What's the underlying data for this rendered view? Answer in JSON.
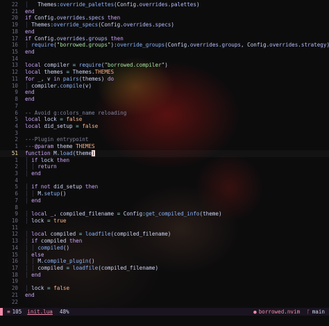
{
  "editor": {
    "lines": [
      {
        "num": "22",
        "sign": "",
        "tokens": [
          [
            "guide",
            "│ "
          ],
          [
            "id",
            "  Themes"
          ],
          [
            "op",
            ":"
          ],
          [
            "fn",
            "override_palettes"
          ],
          [
            "id",
            "(Config"
          ],
          [
            "op",
            "."
          ],
          [
            "field",
            "overrides"
          ],
          [
            "op",
            "."
          ],
          [
            "field",
            "palettes"
          ],
          [
            "id",
            ")"
          ]
        ]
      },
      {
        "num": "21",
        "sign": "",
        "tokens": [
          [
            "kw",
            "end"
          ]
        ]
      },
      {
        "num": "20",
        "sign": "",
        "tokens": [
          [
            "kw",
            "if "
          ],
          [
            "id",
            "Config"
          ],
          [
            "op",
            "."
          ],
          [
            "field",
            "overrides"
          ],
          [
            "op",
            "."
          ],
          [
            "field",
            "specs"
          ],
          [
            "kw",
            " then"
          ]
        ]
      },
      {
        "num": "19",
        "sign": "",
        "tokens": [
          [
            "guide",
            "│ "
          ],
          [
            "id",
            "Themes"
          ],
          [
            "op",
            ":"
          ],
          [
            "fn",
            "override_specs"
          ],
          [
            "id",
            "(Config"
          ],
          [
            "op",
            "."
          ],
          [
            "field",
            "overrides"
          ],
          [
            "op",
            "."
          ],
          [
            "field",
            "specs"
          ],
          [
            "id",
            ")"
          ]
        ]
      },
      {
        "num": "18",
        "sign": "",
        "tokens": [
          [
            "kw",
            "end"
          ]
        ]
      },
      {
        "num": "17",
        "sign": "",
        "tokens": [
          [
            "kw",
            "if "
          ],
          [
            "id",
            "Config"
          ],
          [
            "op",
            "."
          ],
          [
            "field",
            "overrides"
          ],
          [
            "op",
            "."
          ],
          [
            "field",
            "groups"
          ],
          [
            "kw",
            " then"
          ]
        ]
      },
      {
        "num": "16",
        "sign": "",
        "tokens": [
          [
            "guide",
            "│ "
          ],
          [
            "fn",
            "require"
          ],
          [
            "id",
            "("
          ],
          [
            "str",
            "\"borrowed.groups\""
          ],
          [
            "id",
            ")"
          ],
          [
            "op",
            ":"
          ],
          [
            "fn",
            "override_groups"
          ],
          [
            "id",
            "(Config"
          ],
          [
            "op",
            "."
          ],
          [
            "field",
            "overrides"
          ],
          [
            "op",
            "."
          ],
          [
            "field",
            "groups"
          ],
          [
            "id",
            ", Config"
          ],
          [
            "op",
            "."
          ],
          [
            "field",
            "overrides"
          ],
          [
            "op",
            "."
          ],
          [
            "field",
            "strategy"
          ],
          [
            "id",
            ")"
          ]
        ]
      },
      {
        "num": "15",
        "sign": "",
        "tokens": [
          [
            "kw",
            "end"
          ]
        ]
      },
      {
        "num": "14",
        "sign": "",
        "tokens": []
      },
      {
        "num": "13",
        "sign": "",
        "tokens": [
          [
            "kw",
            "local "
          ],
          [
            "id",
            "compiler "
          ],
          [
            "op",
            "= "
          ],
          [
            "fn",
            "require"
          ],
          [
            "id",
            "("
          ],
          [
            "str",
            "\"borrowed.compiler\""
          ],
          [
            "id",
            ")"
          ]
        ]
      },
      {
        "num": "12",
        "sign": "",
        "tokens": [
          [
            "kw",
            "local "
          ],
          [
            "id",
            "themes "
          ],
          [
            "op",
            "= "
          ],
          [
            "id",
            "Themes"
          ],
          [
            "op",
            "."
          ],
          [
            "bool",
            "THEMES"
          ]
        ]
      },
      {
        "num": "11",
        "sign": "",
        "tokens": [
          [
            "kw",
            "for "
          ],
          [
            "id",
            "_, v "
          ],
          [
            "kw",
            "in "
          ],
          [
            "fn",
            "pairs"
          ],
          [
            "id",
            "(themes) "
          ],
          [
            "kw",
            "do"
          ]
        ]
      },
      {
        "num": "10",
        "sign": "",
        "tokens": [
          [
            "guide",
            "│ "
          ],
          [
            "id",
            "compiler"
          ],
          [
            "op",
            "."
          ],
          [
            "fn",
            "compile"
          ],
          [
            "id",
            "(v)"
          ]
        ]
      },
      {
        "num": "9",
        "sign": "",
        "tokens": [
          [
            "kw",
            "end"
          ]
        ]
      },
      {
        "num": "8",
        "sign": "",
        "tokens": [
          [
            "kw",
            "end"
          ]
        ]
      },
      {
        "num": "7",
        "sign": "",
        "tokens": []
      },
      {
        "num": "6",
        "sign": "",
        "tokens": [
          [
            "cm",
            "-- Avoid g:colors_name reloading"
          ]
        ]
      },
      {
        "num": "5",
        "sign": "",
        "tokens": [
          [
            "kw",
            "local "
          ],
          [
            "id",
            "lock "
          ],
          [
            "op",
            "= "
          ],
          [
            "bool",
            "false"
          ]
        ]
      },
      {
        "num": "4",
        "sign": "",
        "tokens": [
          [
            "kw",
            "local "
          ],
          [
            "id",
            "did_setup "
          ],
          [
            "op",
            "= "
          ],
          [
            "bool",
            "false"
          ]
        ]
      },
      {
        "num": "3",
        "sign": "",
        "tokens": []
      },
      {
        "num": "2",
        "sign": "",
        "tokens": [
          [
            "cm",
            "---Plugin entrypoint"
          ]
        ]
      },
      {
        "num": "1",
        "sign": "",
        "tokens": [
          [
            "cm",
            "---"
          ],
          [
            "tag",
            "@param "
          ],
          [
            "id",
            "theme "
          ],
          [
            "bool",
            "THEMES"
          ]
        ]
      },
      {
        "num": "51",
        "sign": "",
        "current": true,
        "tokens": [
          [
            "kw",
            "function "
          ],
          [
            "id",
            "M"
          ],
          [
            "op",
            "."
          ],
          [
            "fn",
            "load"
          ],
          [
            "id",
            "(theme"
          ],
          [
            "cursor",
            ")"
          ]
        ]
      },
      {
        "num": "1",
        "sign": "",
        "tokens": [
          [
            "guide",
            "│ "
          ],
          [
            "kw",
            "if "
          ],
          [
            "id",
            "lock "
          ],
          [
            "kw",
            "then"
          ]
        ]
      },
      {
        "num": "2",
        "sign": "",
        "tokens": [
          [
            "guide",
            "│ "
          ],
          [
            "guide",
            "│ "
          ],
          [
            "kw",
            "return"
          ]
        ]
      },
      {
        "num": "3",
        "sign": "",
        "tokens": [
          [
            "guide",
            "│ "
          ],
          [
            "kw",
            "end"
          ]
        ]
      },
      {
        "num": "4",
        "sign": "",
        "tokens": []
      },
      {
        "num": "5",
        "sign": "",
        "tokens": [
          [
            "guide",
            "│ "
          ],
          [
            "kw",
            "if not "
          ],
          [
            "id",
            "did_setup "
          ],
          [
            "kw",
            "then"
          ]
        ]
      },
      {
        "num": "6",
        "sign": "",
        "tokens": [
          [
            "guide",
            "│ "
          ],
          [
            "guide",
            "│ "
          ],
          [
            "id",
            "M"
          ],
          [
            "op",
            "."
          ],
          [
            "fn",
            "setup"
          ],
          [
            "id",
            "()"
          ]
        ]
      },
      {
        "num": "7",
        "sign": "",
        "tokens": [
          [
            "guide",
            "│ "
          ],
          [
            "kw",
            "end"
          ]
        ]
      },
      {
        "num": "8",
        "sign": "",
        "tokens": []
      },
      {
        "num": "9",
        "sign": "",
        "tokens": [
          [
            "guide",
            "│ "
          ],
          [
            "kw",
            "local "
          ],
          [
            "id",
            "_, compiled_filename "
          ],
          [
            "op",
            "= "
          ],
          [
            "id",
            "Config"
          ],
          [
            "op",
            ":"
          ],
          [
            "fn",
            "get_compiled_info"
          ],
          [
            "id",
            "(theme)"
          ]
        ]
      },
      {
        "num": "10",
        "sign": "",
        "tokens": [
          [
            "guide",
            "│ "
          ],
          [
            "id",
            "lock "
          ],
          [
            "op",
            "= "
          ],
          [
            "bool",
            "true"
          ]
        ]
      },
      {
        "num": "11",
        "sign": "",
        "tokens": []
      },
      {
        "num": "12",
        "sign": "",
        "tokens": [
          [
            "guide",
            "│ "
          ],
          [
            "kw",
            "local "
          ],
          [
            "id",
            "compiled "
          ],
          [
            "op",
            "= "
          ],
          [
            "fn",
            "loadfile"
          ],
          [
            "id",
            "(compiled_filename)"
          ]
        ]
      },
      {
        "num": "13",
        "sign": "",
        "tokens": [
          [
            "guide",
            "│ "
          ],
          [
            "kw",
            "if "
          ],
          [
            "id",
            "compiled "
          ],
          [
            "kw",
            "then"
          ]
        ]
      },
      {
        "num": "14",
        "sign": "",
        "tokens": [
          [
            "guide",
            "│ "
          ],
          [
            "guide",
            "│ "
          ],
          [
            "fn",
            "compiled"
          ],
          [
            "id",
            "()"
          ]
        ]
      },
      {
        "num": "15",
        "sign": "",
        "tokens": [
          [
            "guide",
            "│ "
          ],
          [
            "kw",
            "else"
          ]
        ]
      },
      {
        "num": "16",
        "sign": "",
        "tokens": [
          [
            "guide",
            "│ "
          ],
          [
            "guide",
            "│ "
          ],
          [
            "id",
            "M"
          ],
          [
            "op",
            "."
          ],
          [
            "fn",
            "compile_plugin"
          ],
          [
            "id",
            "()"
          ]
        ]
      },
      {
        "num": "17",
        "sign": "",
        "tokens": [
          [
            "guide",
            "│ "
          ],
          [
            "guide",
            "│ "
          ],
          [
            "id",
            "compiled "
          ],
          [
            "op",
            "= "
          ],
          [
            "fn",
            "loadfile"
          ],
          [
            "id",
            "(compiled_filename)"
          ]
        ]
      },
      {
        "num": "18",
        "sign": "",
        "tokens": [
          [
            "guide",
            "│ "
          ],
          [
            "kw",
            "end"
          ]
        ]
      },
      {
        "num": "19",
        "sign": "",
        "tokens": []
      },
      {
        "num": "20",
        "sign": "",
        "tokens": [
          [
            "guide",
            "│ "
          ],
          [
            "id",
            "lock "
          ],
          [
            "op",
            "= "
          ],
          [
            "bool",
            "false"
          ]
        ]
      },
      {
        "num": "21",
        "sign": "",
        "tokens": [
          [
            "kw",
            "end"
          ]
        ]
      },
      {
        "num": "22",
        "sign": "",
        "tokens": []
      }
    ],
    "current_line_num": "51",
    "sign_marker": "▎"
  },
  "statusline": {
    "lines_icon": "≡",
    "lines_count": "105",
    "filename": "init.lua",
    "percent": "48%",
    "repo_icon": "●",
    "repo": "borrowed.nvim",
    "branch_icon": "ᚴ",
    "branch": "main"
  },
  "colors": {
    "accent": "#f38ba8",
    "keyword": "#cba6f7",
    "string": "#a6e3a1",
    "function": "#89b4fa",
    "boolean": "#fab387"
  }
}
